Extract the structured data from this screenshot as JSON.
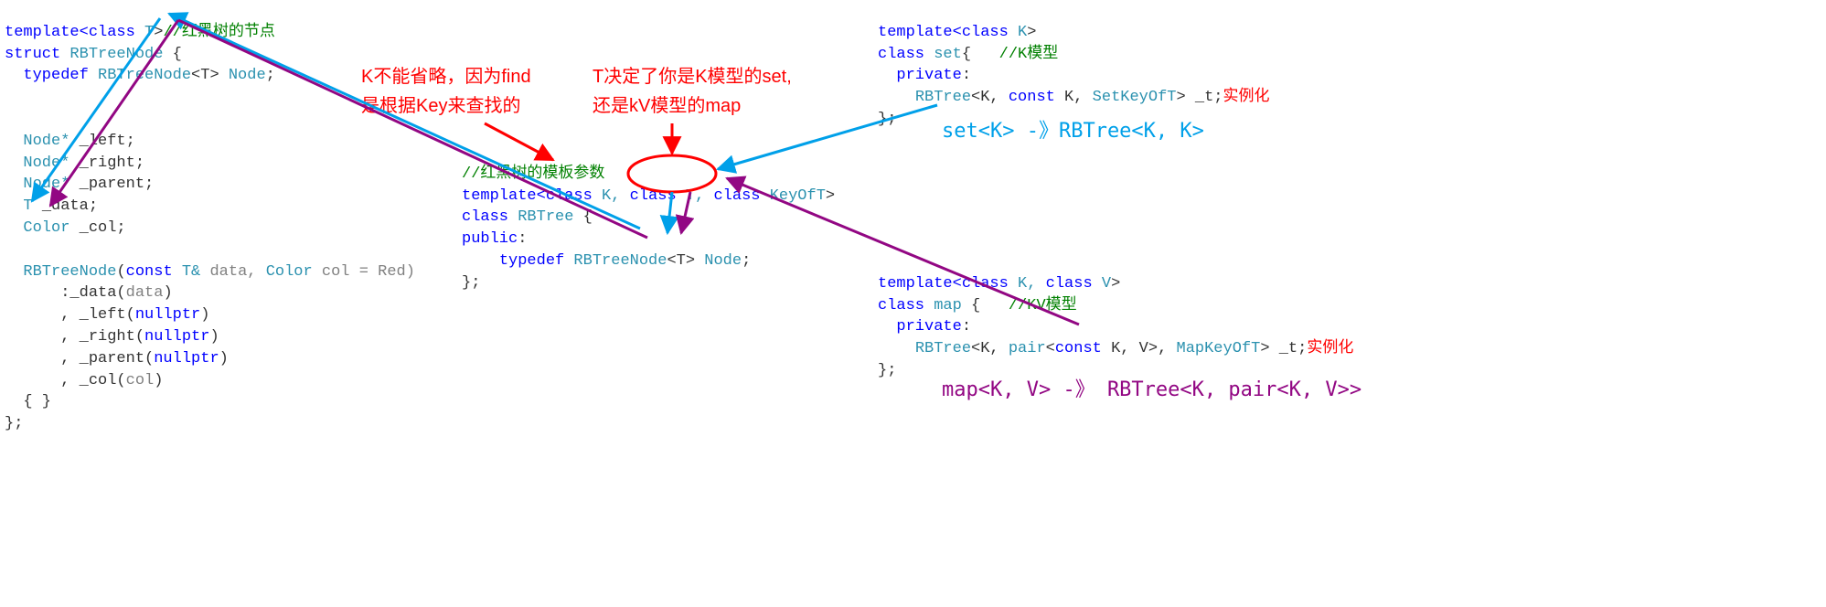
{
  "node_block": {
    "line1_pre": "template<",
    "line1_kw": "class",
    "line1_tparam": " T",
    "line1_post": ">",
    "line1_comment": "//红黑树的节点",
    "line2_kw": "struct",
    "line2_name": " RBTreeNode",
    "line2_post": " {",
    "line3_kw": "typedef",
    "line3_name": " RBTreeNode",
    "line3_tpl": "<T>",
    "line3_alias": " Node",
    "line3_end": ";",
    "left_type": "Node* ",
    "left_name": "_left;",
    "right_type": "Node* ",
    "right_name": "_right;",
    "parent_type": "Node* ",
    "parent_name": "_parent;",
    "data_type": "T ",
    "data_name": "_data;",
    "col_type": "Color ",
    "col_name": "_col;",
    "ctor_name": "RBTreeNode",
    "ctor_pre": "(",
    "ctor_const": "const",
    "ctor_t": " T& ",
    "ctor_param1": "data, ",
    "ctor_coltype": "Color ",
    "ctor_param2": "col = Red)",
    "init1_pre": "    :_data(",
    "init1_arg": "data",
    "init1_post": ")",
    "init2_pre": "    , _left(",
    "init2_arg": "nullptr",
    "init2_post": ")",
    "init3_pre": "    , _right(",
    "init3_arg": "nullptr",
    "init3_post": ")",
    "init4_pre": "    , _parent(",
    "init4_arg": "nullptr",
    "init4_post": ")",
    "init5_pre": "    , _col(",
    "init5_arg": "col",
    "init5_post": ")",
    "body": "{ }",
    "close": "};"
  },
  "tree_block": {
    "comment": "//红黑树的模板参数",
    "line1_pre": "template<",
    "line1_kw1": "class",
    "line1_p1": " K, ",
    "line1_kw2": "class",
    "line1_p2": " T, ",
    "line1_kw3": "class",
    "line1_p3": " KeyOfT",
    "line1_post": ">",
    "line2_kw": "class",
    "line2_name": " RBTree",
    "line2_post": " {",
    "public": "public",
    "public_post": ":",
    "typedef_kw": "typedef",
    "typedef_name": " RBTreeNode",
    "typedef_tpl": "<T>",
    "typedef_alias": " Node",
    "typedef_end": ";",
    "close": "};"
  },
  "set_block": {
    "line1_pre": "template<",
    "line1_kw": "class",
    "line1_p": " K",
    "line1_post": ">",
    "line2_kw": "class",
    "line2_name": " set",
    "line2_post": "{",
    "line2_comment": "   //K模型",
    "private": "private",
    "private_post": ":",
    "member_type": "RBTree",
    "member_tpl_open": "<K, ",
    "member_const": "const",
    "member_tpl_mid": " K, ",
    "member_keyoft": "SetKeyOfT",
    "member_tpl_close": ">",
    "member_name": " _t;",
    "instance_comment": "实例化",
    "close": "};"
  },
  "map_block": {
    "line1_pre": "template<",
    "line1_kw1": "class",
    "line1_p1": " K, ",
    "line1_kw2": "class",
    "line1_p2": " V",
    "line1_post": ">",
    "line2_kw": "class",
    "line2_name": " map",
    "line2_post": " {",
    "line2_comment": "   //KV模型",
    "private": "private",
    "private_post": ":",
    "member_type": "RBTree",
    "member_tpl_open": "<K, ",
    "member_pair": "pair",
    "member_pair_open": "<",
    "member_const": "const",
    "member_pair_mid": " K, V>, ",
    "member_keyoft": "MapKeyOfT",
    "member_tpl_close": ">",
    "member_name": " _t;",
    "instance_comment": "实例化",
    "close": "};"
  },
  "annotations": {
    "red1_line1": "K不能省略，因为find",
    "red1_line2": "是根据Key来查找的",
    "red2_line1": "T决定了你是K模型的set,",
    "red2_line2": "还是kV模型的map",
    "blue_set": "set<K> -》RBTree<K, K>",
    "purple_map": "map<K, V> -》 RBTree<K, pair<K, V>>"
  }
}
